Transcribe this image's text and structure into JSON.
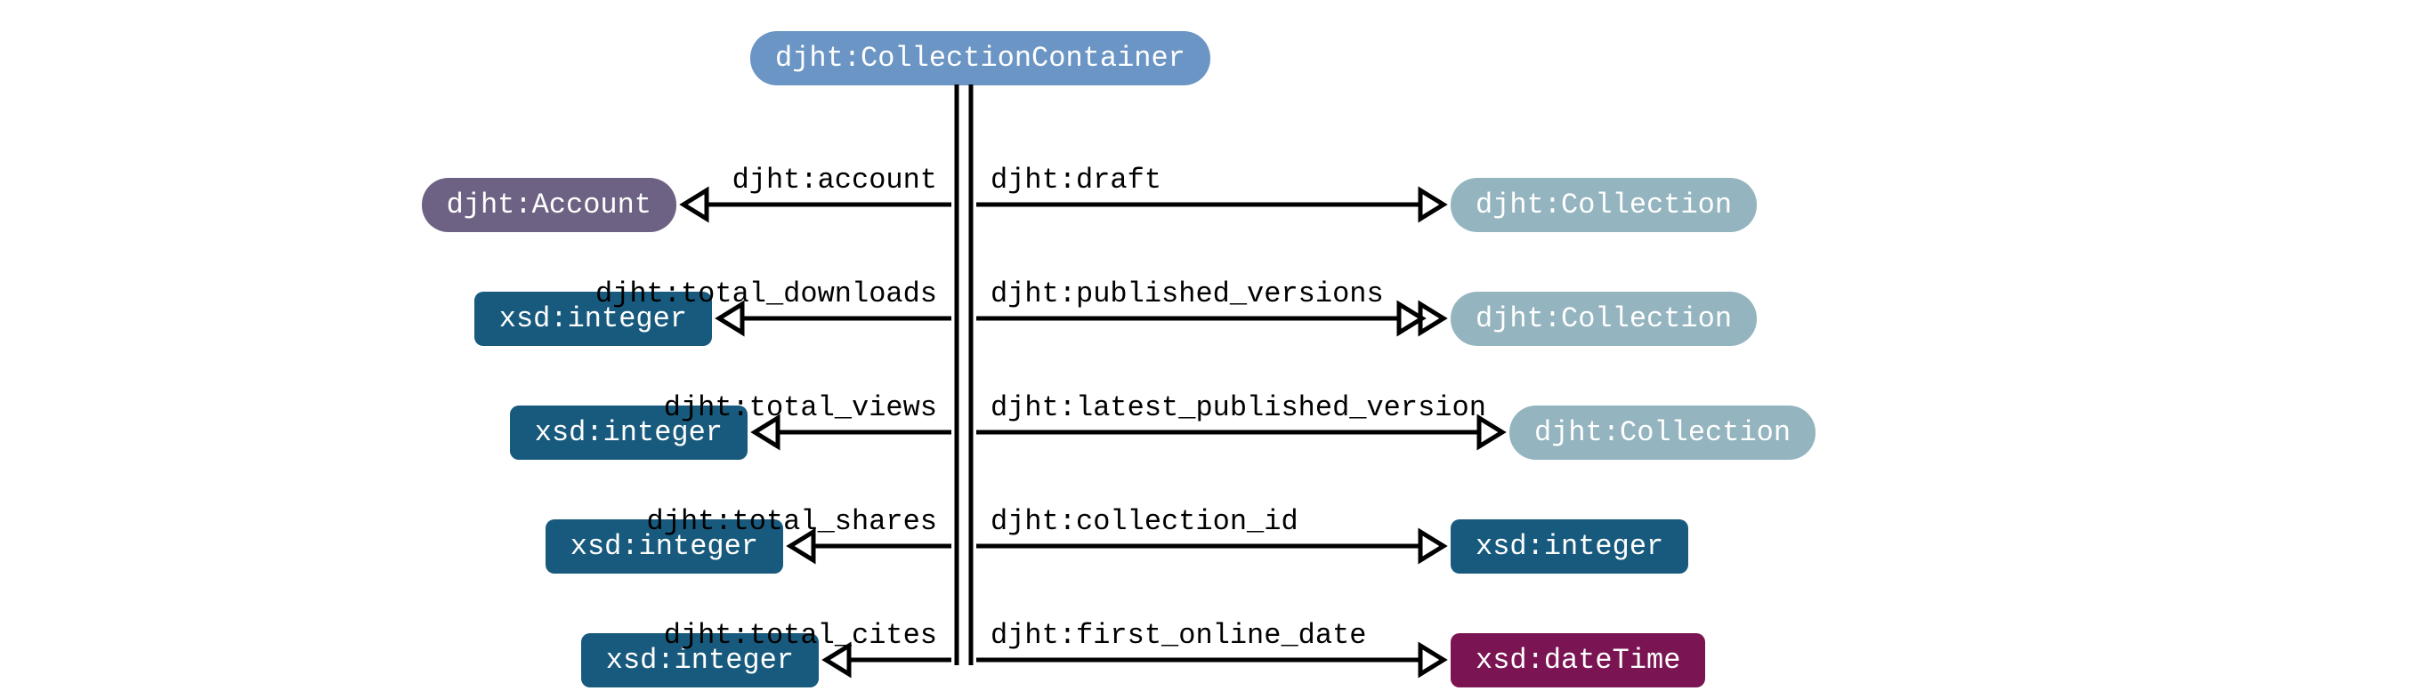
{
  "root": {
    "label": "djht:CollectionContainer",
    "color": "#6b95c4"
  },
  "left": [
    {
      "edge": "djht:account",
      "node": "djht:Account",
      "color": "#6d6283",
      "pill": true
    },
    {
      "edge": "djht:total_downloads",
      "node": "xsd:integer",
      "color": "#185a7d",
      "pill": false
    },
    {
      "edge": "djht:total_views",
      "node": "xsd:integer",
      "color": "#185a7d",
      "pill": false
    },
    {
      "edge": "djht:total_shares",
      "node": "xsd:integer",
      "color": "#185a7d",
      "pill": false
    },
    {
      "edge": "djht:total_cites",
      "node": "xsd:integer",
      "color": "#185a7d",
      "pill": false
    }
  ],
  "right": [
    {
      "edge": "djht:draft",
      "node": "djht:Collection",
      "color": "#94b4bf",
      "pill": true,
      "double": false
    },
    {
      "edge": "djht:published_versions",
      "node": "djht:Collection",
      "color": "#94b4bf",
      "pill": true,
      "double": true
    },
    {
      "edge": "djht:latest_published_version",
      "node": "djht:Collection",
      "color": "#94b4bf",
      "pill": true,
      "double": false
    },
    {
      "edge": "djht:collection_id",
      "node": "xsd:integer",
      "color": "#185a7d",
      "pill": false,
      "double": false
    },
    {
      "edge": "djht:first_online_date",
      "node": "xsd:dateTime",
      "color": "#7a1452",
      "pill": false,
      "double": false
    }
  ],
  "layout": {
    "centerX": 1083,
    "rootY": 35,
    "rowStartY": 230,
    "rowGap": 128,
    "leftNodeRight": 760,
    "rightNodeLeft": 1630,
    "labelGap": 20,
    "arrowGap": 14
  }
}
